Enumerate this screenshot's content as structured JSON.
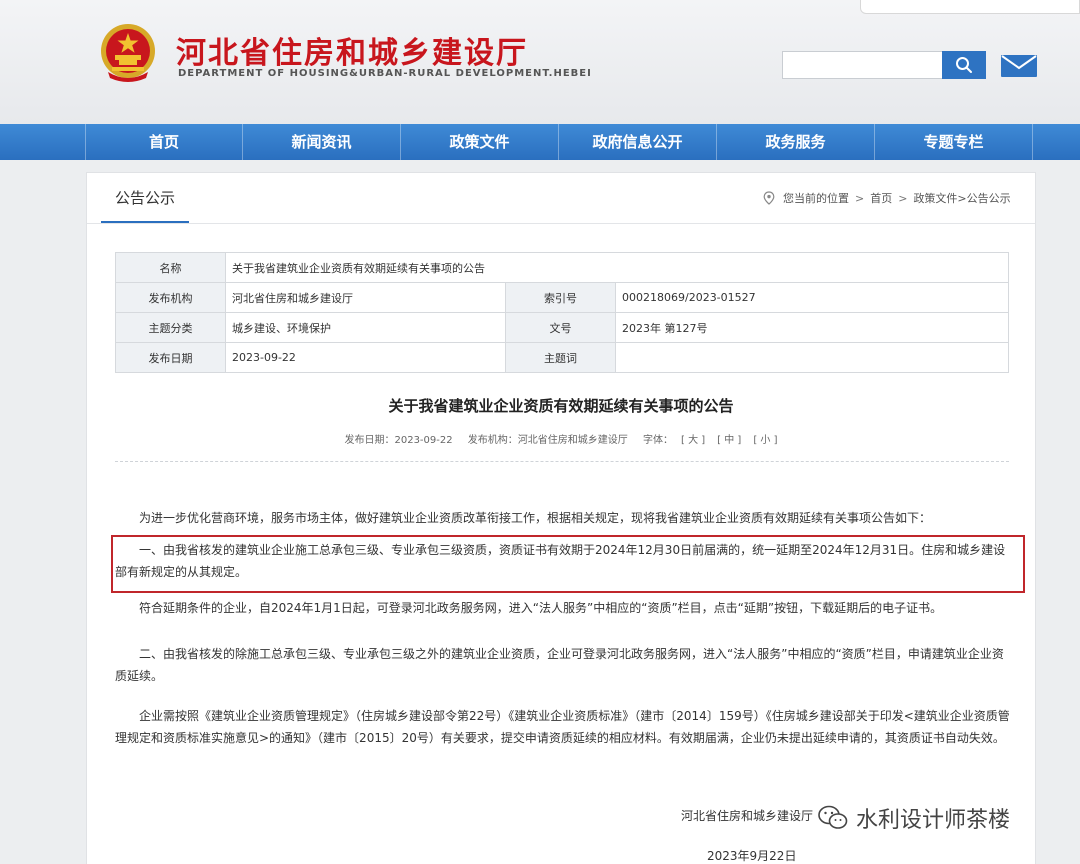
{
  "header": {
    "title": "河北省住房和城乡建设厅",
    "subtitle": "DEPARTMENT OF HOUSING&URBAN-RURAL DEVELOPMENT.HEBEI",
    "search": {
      "value": "",
      "placeholder": ""
    }
  },
  "nav": {
    "items": [
      {
        "label": "首页"
      },
      {
        "label": "新闻资讯"
      },
      {
        "label": "政策文件"
      },
      {
        "label": "政府信息公开"
      },
      {
        "label": "政务服务"
      },
      {
        "label": "专题专栏"
      }
    ]
  },
  "section": {
    "tab_label": "公告公示",
    "breadcrumb": {
      "prefix": "您当前的位置",
      "items": [
        "首页",
        "政策文件>公告公示"
      ]
    }
  },
  "info": {
    "name_label": "名称",
    "name_value": "关于我省建筑业企业资质有效期延续有关事项的公告",
    "org_label": "发布机构",
    "org_value": "河北省住房和城乡建设厅",
    "index_label": "索引号",
    "index_value": "000218069/2023-01527",
    "topic_label": "主题分类",
    "topic_value": "城乡建设、环境保护",
    "docno_label": "文号",
    "docno_value": "2023年 第127号",
    "date_label": "发布日期",
    "date_value": "2023-09-22",
    "keywords_label": "主题词",
    "keywords_value": ""
  },
  "article": {
    "title": "关于我省建筑业企业资质有效期延续有关事项的公告",
    "meta": {
      "date": "发布日期：2023-09-22",
      "org": "发布机构：河北省住房和城乡建设厅",
      "font_label": "字体：",
      "font_large": "[ 大 ]",
      "font_medium": "[ 中 ]",
      "font_small": "[ 小 ]"
    },
    "paragraphs": [
      "为进一步优化营商环境，服务市场主体，做好建筑业企业资质改革衔接工作，根据相关规定，现将我省建筑业企业资质有效期延续有关事项公告如下：",
      "一、由我省核发的建筑业企业施工总承包三级、专业承包三级资质，资质证书有效期于2024年12月30日前届满的，统一延期至2024年12月31日。住房和城乡建设部有新规定的从其规定。",
      "符合延期条件的企业，自2024年1月1日起，可登录河北政务服务网，进入“法人服务”中相应的“资质”栏目，点击“延期”按钮，下载延期后的电子证书。",
      "二、由我省核发的除施工总承包三级、专业承包三级之外的建筑业企业资质，企业可登录河北政务服务网，进入“法人服务”中相应的“资质”栏目，申请建筑业企业资质延续。",
      "企业需按照《建筑业企业资质管理规定》（住房城乡建设部令第22号）《建筑业企业资质标准》（建市〔2014〕159号）《住房城乡建设部关于印发<建筑业企业资质管理规定和资质标准实施意见>的通知》（建市〔2015〕20号）有关要求，提交申请资质延续的相应材料。有效期届满，企业仍未提出延续申请的，其资质证书自动失效。"
    ],
    "sign_org": "河北省住房和城乡建设厅",
    "sign_date": "2023年9月22日"
  },
  "watermark": {
    "text": "水利设计师茶楼"
  },
  "colors": {
    "brand_red": "#c8161d",
    "nav_blue": "#2a6fbf",
    "highlight_red": "#c0262b"
  },
  "icons": {
    "emblem": "national-emblem-icon",
    "search": "search-icon",
    "mail": "mail-icon",
    "location": "location-pin-icon",
    "watermark": "wechat-icon"
  }
}
